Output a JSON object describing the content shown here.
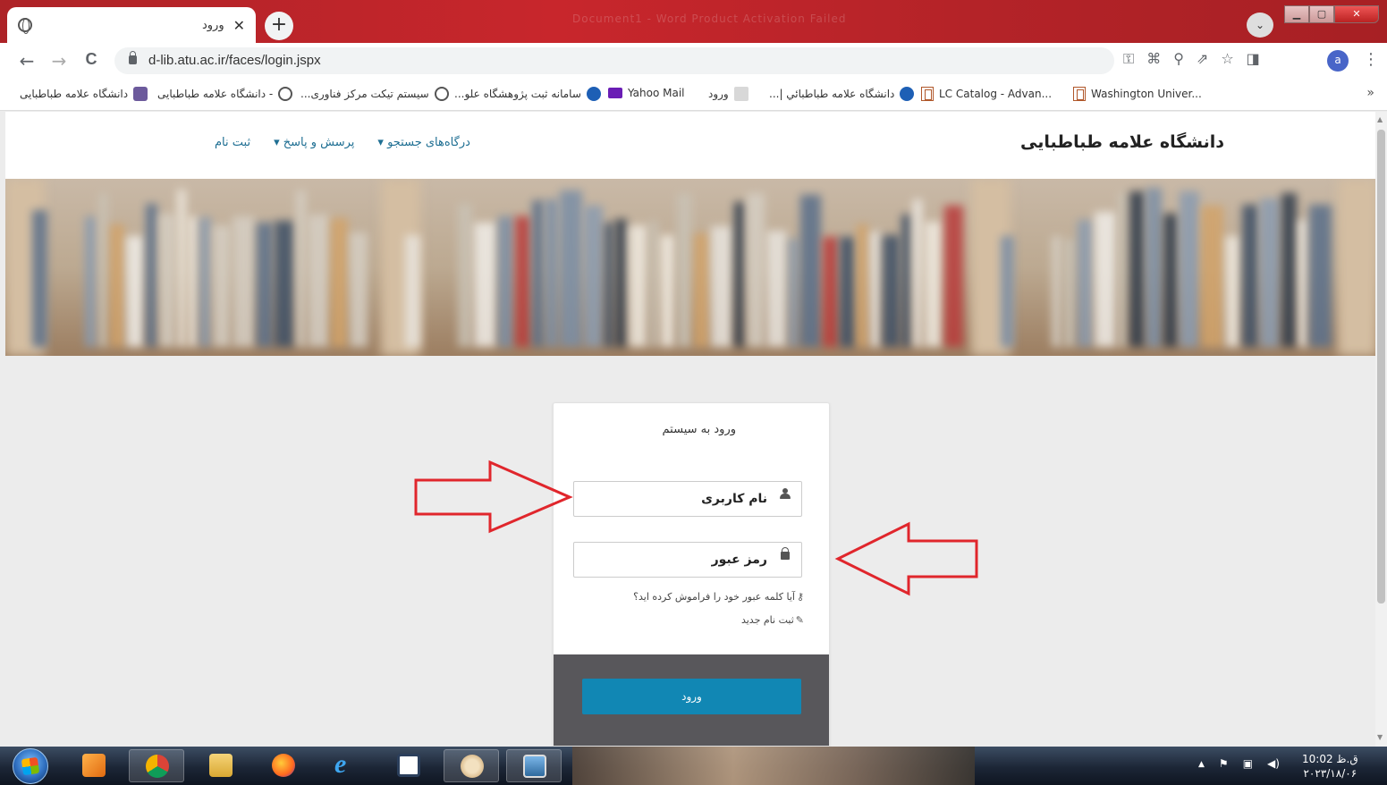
{
  "browser": {
    "tab_title": "ورود",
    "tab_close": "✕",
    "new_tab": "+",
    "tab_search": "⌄",
    "background_title_ghost": "Document1 - Word Product Activation Failed",
    "window_buttons": {
      "minimize": "▁",
      "maximize": "▢",
      "close": "✕"
    },
    "url": "d-lib.atu.ac.ir/faces/login.jspx",
    "nav": {
      "back": "←",
      "forward": "→",
      "reload": "C"
    },
    "tool_icons": [
      "key-icon",
      "translate-icon",
      "zoom-icon",
      "share-icon",
      "star-icon",
      "sidepanel-icon"
    ],
    "tool_glyphs": [
      "⚿",
      "⌘",
      "⚲",
      "⇗",
      "☆",
      "◨"
    ],
    "avatar_letter": "a",
    "menu": "⋮",
    "bookmarks": [
      {
        "label": "Washington Univer...",
        "icon": "loc-icon"
      },
      {
        "label": "LC Catalog - Advan...",
        "icon": "loc-icon"
      },
      {
        "label": "دانشگاه علامه طباطبائي |...",
        "icon": "crest-icon"
      },
      {
        "label": "ورود",
        "icon": "site-icon"
      },
      {
        "label": "Yahoo Mail",
        "icon": "mail-icon"
      },
      {
        "label": "سامانه ثبت پژوهشگاه علو...",
        "icon": "globe-icon"
      },
      {
        "label": "سیستم تیکت مرکز فناوری...",
        "icon": "globe-icon"
      },
      {
        "label": "- دانشگاه علامه طباطبایی",
        "icon": "globe-icon"
      },
      {
        "label": "دانشگاه علامه طباطبایی",
        "icon": "crest-icon"
      }
    ],
    "bookmarks_more": "»"
  },
  "site": {
    "brand": "دانشگاه علامه طباطبایی",
    "nav": [
      {
        "label": "ثبت نام"
      },
      {
        "label": "پرسش و پاسخ ▾"
      },
      {
        "label": "درگاه‌های جستجو ▾"
      }
    ]
  },
  "login": {
    "title": "ورود به سیستم",
    "username_placeholder": "نام کاربری",
    "password_placeholder": "رمز عبور",
    "forgot_password": "آیا کلمه عبور خود را فراموش کرده اید؟",
    "register": "ثبت نام جدید",
    "submit": "ورود"
  },
  "colors": {
    "accent": "#1187b4",
    "nav_link": "#1f6f93",
    "annotation_arrow": "#e0262c",
    "footer": "#58575b"
  },
  "taskbar": {
    "apps": [
      "media-player-icon",
      "chrome-icon",
      "file-explorer-icon",
      "firefox-icon",
      "internet-explorer-icon",
      "window-icon",
      "paint-icon",
      "photo-viewer-icon"
    ],
    "tray": {
      "expand": "▲",
      "flag": "⚑",
      "network": "▣",
      "volume": "◀)"
    },
    "clock_time": "ق.ظ 10:02",
    "clock_date": "۲۰۲۳/۱۸/۰۶"
  }
}
